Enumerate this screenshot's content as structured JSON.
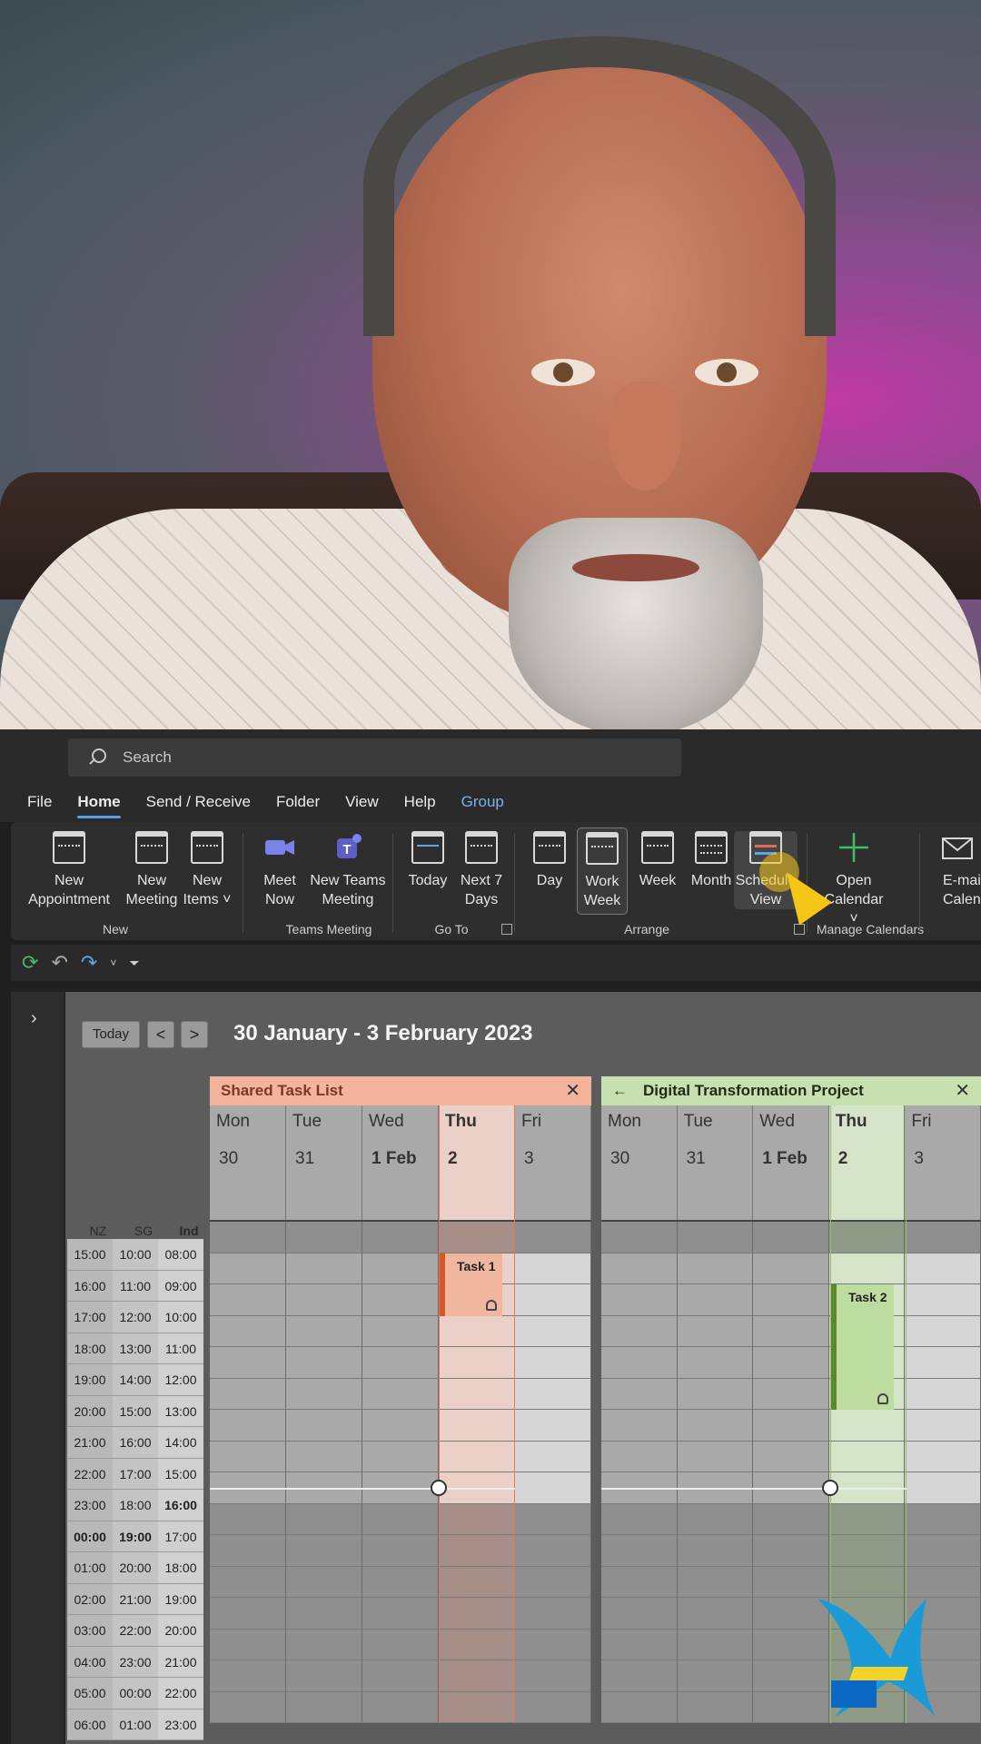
{
  "search": {
    "placeholder": "Search"
  },
  "menu": [
    {
      "label": "File"
    },
    {
      "label": "Home"
    },
    {
      "label": "Send / Receive"
    },
    {
      "label": "Folder"
    },
    {
      "label": "View"
    },
    {
      "label": "Help"
    },
    {
      "label": "Group"
    }
  ],
  "ribbon": {
    "new_appointment": [
      "New",
      "Appointment"
    ],
    "new_meeting": [
      "New",
      "Meeting"
    ],
    "new_items": [
      "New",
      "Items ˅"
    ],
    "group_new": "New",
    "meet_now": [
      "Meet",
      "Now"
    ],
    "new_teams_meeting": [
      "New Teams",
      "Meeting"
    ],
    "group_teams": "Teams Meeting",
    "today": "Today",
    "next7": [
      "Next 7",
      "Days"
    ],
    "group_goto": "Go To",
    "day": "Day",
    "work_week": [
      "Work",
      "Week"
    ],
    "week": "Week",
    "month": "Month",
    "schedule_view": [
      "Schedule",
      "View"
    ],
    "group_arrange": "Arrange",
    "open_calendar": [
      "Open",
      "Calendar ˅"
    ],
    "group_manage": "Manage Calendars",
    "email_calendar": [
      "E-mail",
      "Calendar"
    ]
  },
  "calendar": {
    "today_button": "Today",
    "prev": "<",
    "next": ">",
    "range": "30 January - 3 February 2023",
    "timezones": [
      "NZ",
      "SG",
      "Ind"
    ],
    "rows": [
      [
        "15:00",
        "10:00",
        "08:00"
      ],
      [
        "16:00",
        "11:00",
        "09:00"
      ],
      [
        "17:00",
        "12:00",
        "10:00"
      ],
      [
        "18:00",
        "13:00",
        "11:00"
      ],
      [
        "19:00",
        "14:00",
        "12:00"
      ],
      [
        "20:00",
        "15:00",
        "13:00"
      ],
      [
        "21:00",
        "16:00",
        "14:00"
      ],
      [
        "22:00",
        "17:00",
        "15:00"
      ],
      [
        "23:00",
        "18:00",
        "16:00"
      ],
      [
        "00:00",
        "19:00",
        "17:00"
      ],
      [
        "01:00",
        "20:00",
        "18:00"
      ],
      [
        "02:00",
        "21:00",
        "19:00"
      ],
      [
        "03:00",
        "22:00",
        "20:00"
      ],
      [
        "04:00",
        "23:00",
        "21:00"
      ],
      [
        "05:00",
        "00:00",
        "22:00"
      ],
      [
        "06:00",
        "01:00",
        "23:00"
      ]
    ],
    "panes": [
      {
        "title": "Shared Task List",
        "close": "✕",
        "days": [
          "Mon",
          "Tue",
          "Wed",
          "Thu",
          "Fri"
        ],
        "dates": [
          "30",
          "31",
          "1 Feb",
          "2",
          "3"
        ],
        "task": "Task 1"
      },
      {
        "title": "Digital Transformation Project",
        "back": "←",
        "close": "✕",
        "days": [
          "Mon",
          "Tue",
          "Wed",
          "Thu",
          "Fri"
        ],
        "dates": [
          "30",
          "31",
          "1 Feb",
          "2",
          "3"
        ],
        "task": "Task 2"
      }
    ]
  },
  "colors": {
    "accent_blue": "#4ea2f0",
    "pane1_header": "#f4b49c",
    "pane1_event": "#f0b6a0",
    "pane1_bar": "#d8572a",
    "pane2_header": "#c6e0b0",
    "pane2_event": "#bcdca0",
    "pane2_bar": "#5c8a2a"
  }
}
